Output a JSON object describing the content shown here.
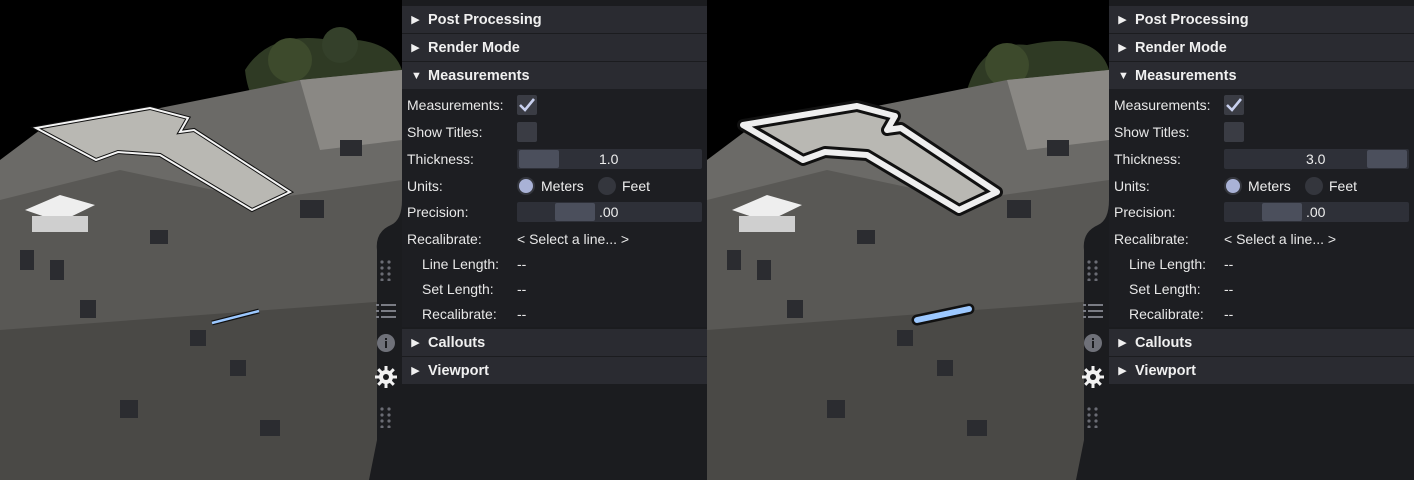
{
  "sections": {
    "post_processing": "Post Processing",
    "render_mode": "Render Mode",
    "measurements": "Measurements",
    "callouts": "Callouts",
    "viewport": "Viewport"
  },
  "fields": {
    "measurements_label": "Measurements:",
    "show_titles_label": "Show Titles:",
    "thickness_label": "Thickness:",
    "units_label": "Units:",
    "meters_label": "Meters",
    "feet_label": "Feet",
    "precision_label": "Precision:",
    "precision_value": ".00",
    "recalibrate_label": "Recalibrate:",
    "select_line": "< Select a line... >",
    "line_length_label": "Line Length:",
    "set_length_label": "Set Length:",
    "recalibrate_sub_label": "Recalibrate:",
    "dash": "--"
  },
  "left": {
    "thickness_value": "1.0",
    "thickness_fraction": 0.0
  },
  "right": {
    "thickness_value": "3.0",
    "thickness_fraction": 1.0
  },
  "state": {
    "measurements_checked": true,
    "show_titles_checked": false,
    "units_selected": "Meters"
  },
  "icons": [
    "drag-handle-icon",
    "list-icon",
    "info-icon",
    "gear-icon",
    "drag-handle-icon"
  ],
  "colors": {
    "panel": "#1b1c1f",
    "header": "#2a2b31",
    "accent": "#a9b2d6",
    "highlight_line": "#9cc8ff"
  }
}
